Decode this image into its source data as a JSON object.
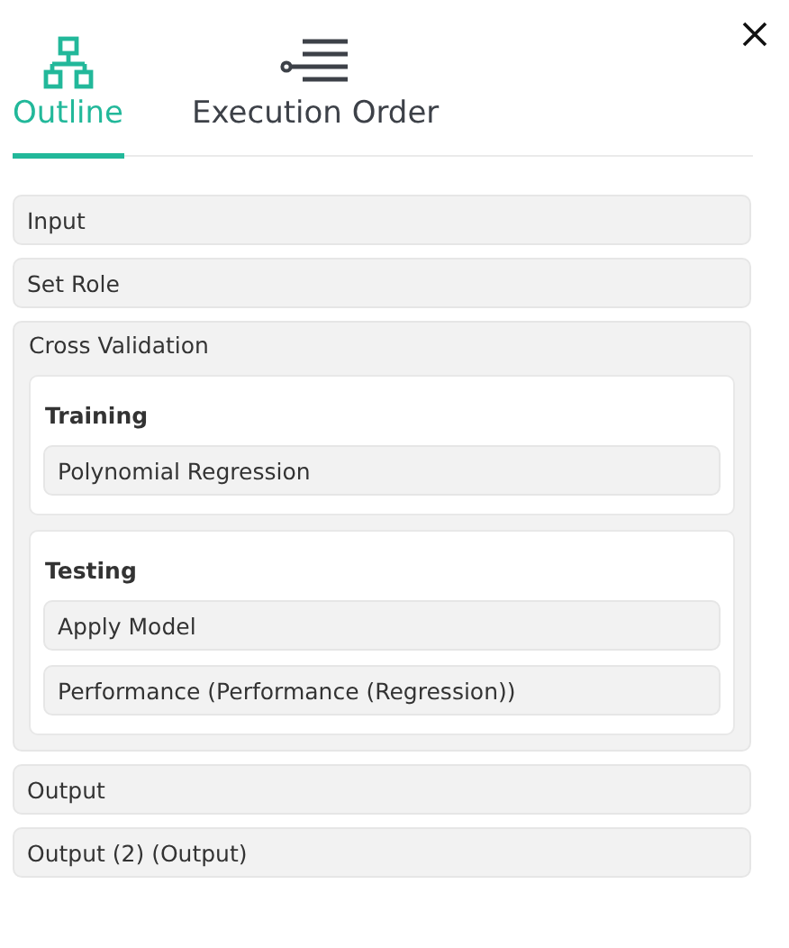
{
  "tabs": [
    {
      "label": "Outline",
      "kind": "outline",
      "selected": true
    },
    {
      "label": "Execution Order",
      "kind": "order",
      "selected": false
    }
  ],
  "items": [
    {
      "kind": "operator",
      "label": "Input"
    },
    {
      "kind": "operator",
      "label": "Set Role"
    },
    {
      "kind": "nested",
      "label": "Cross Validation",
      "sections": [
        {
          "title": "Training",
          "items": [
            {
              "label": "Polynomial Regression"
            }
          ]
        },
        {
          "title": "Testing",
          "items": [
            {
              "label": "Apply Model"
            },
            {
              "label": "Performance (Performance (Regression))"
            }
          ]
        }
      ]
    },
    {
      "kind": "operator",
      "label": "Output"
    },
    {
      "kind": "operator",
      "label": "Output (2) (Output)"
    }
  ]
}
